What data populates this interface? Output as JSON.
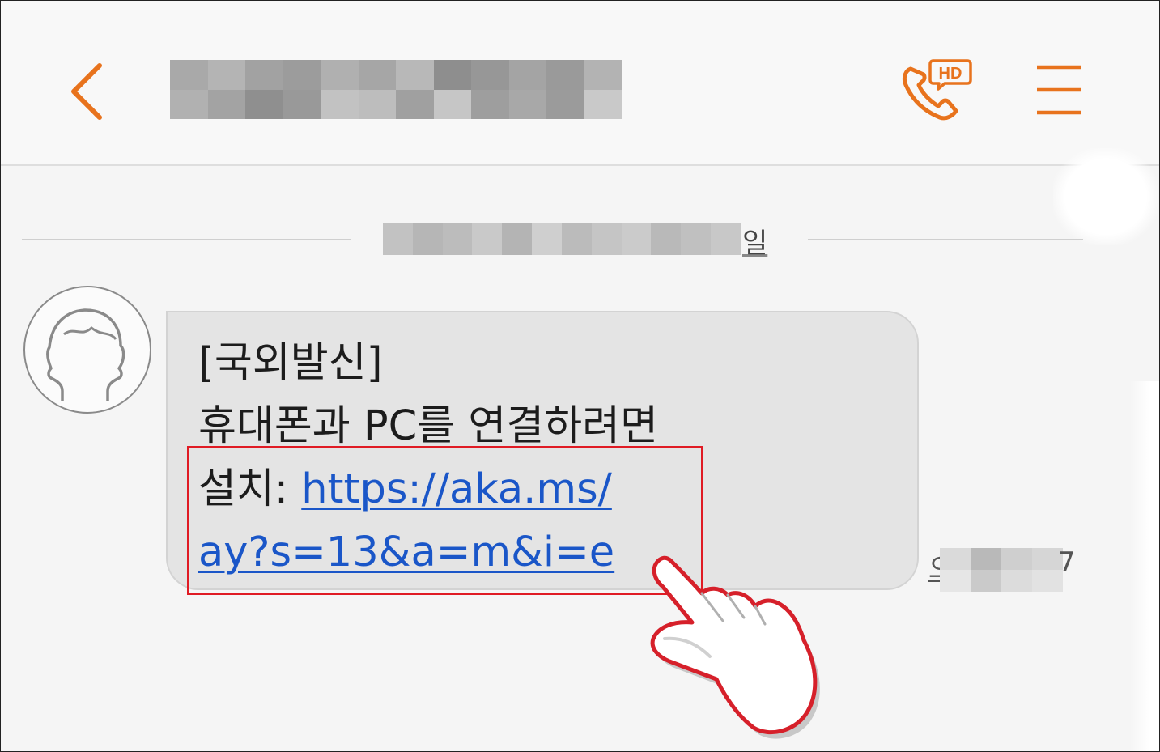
{
  "header": {
    "contact_name_redacted": "",
    "icons": {
      "back": "chevron-left-icon",
      "call": "hd-voice-call-icon",
      "menu": "hamburger-menu-icon"
    },
    "call_badge": "HD",
    "accent_color": "#e8731d"
  },
  "date_divider": {
    "visible_suffix": "일"
  },
  "message": {
    "lines": [
      "[국외발신]",
      "휴대폰과 PC를 연결하려면"
    ],
    "install_label": "설치: ",
    "link_line1": "https://aka.ms/",
    "link_line2": "ay?s=13&a=m&i=e",
    "link_color": "#1a56c8",
    "bubble_color": "#e4e4e4"
  },
  "timestamp": {
    "visible_prefix": "오",
    "visible_suffix": "7"
  },
  "annotation": {
    "highlight_color": "#e01b24",
    "pointer": "pointing-hand-icon"
  }
}
